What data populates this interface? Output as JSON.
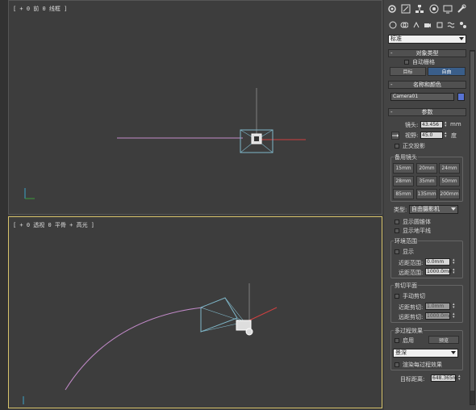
{
  "viewports": {
    "front": {
      "label": "[ + 0 前 0 线框 ]"
    },
    "perspective": {
      "label": "[ + 0 透视 0 平骨 + 高光 ]"
    }
  },
  "panel": {
    "category_dropdown": "标准",
    "object_type": {
      "title": "对象类型",
      "autogrid_label": "自动栅格",
      "target_button": "目标",
      "free_button": "自由"
    },
    "name_color": {
      "title": "名称和颜色",
      "name_value": "Camera01",
      "color": "#5873d3"
    },
    "params": {
      "title": "参数",
      "lens_label": "镜头:",
      "lens_value": "43.456",
      "lens_unit": "mm",
      "fov_label": "视野:",
      "fov_value": "45.0",
      "fov_unit": "度",
      "ortho_label": "正交投影",
      "stock_lenses_title": "备用镜头",
      "stock_lenses": [
        "15mm",
        "20mm",
        "24mm",
        "28mm",
        "35mm",
        "50mm",
        "85mm",
        "135mm",
        "200mm"
      ],
      "type_label": "类型:",
      "type_value": "自由摄影机",
      "show_cone": "显示圆锥体",
      "show_horizon": "显示地平线",
      "env_range_title": "环境范围",
      "env_show": "显示",
      "near_range_label": "近距范围:",
      "near_range_value": "0.0mm",
      "far_range_label": "远距范围:",
      "far_range_value": "1000.0mm",
      "clip_title": "剪切平面",
      "manual_clip": "手动剪切",
      "near_clip_label": "近距剪切:",
      "near_clip_value": "1.0mm",
      "far_clip_label": "远距剪切:",
      "far_clip_value": "1000.0mm",
      "multipass_title": "多过程效果",
      "multipass_enable": "启用",
      "preview_button": "预览",
      "effect_value": "景深",
      "render_each_pass": "渲染每过程效果",
      "target_dist_label": "目标距离:",
      "target_dist_value": "648.365m"
    }
  },
  "icons": [
    "create-icon",
    "modify-icon",
    "hierarchy-icon",
    "motion-icon",
    "display-icon",
    "utilities-icon",
    "geometry-icon",
    "shapes-icon",
    "lights-icon",
    "cameras-icon",
    "helpers-icon",
    "spacewarps-icon",
    "systems-icon"
  ]
}
